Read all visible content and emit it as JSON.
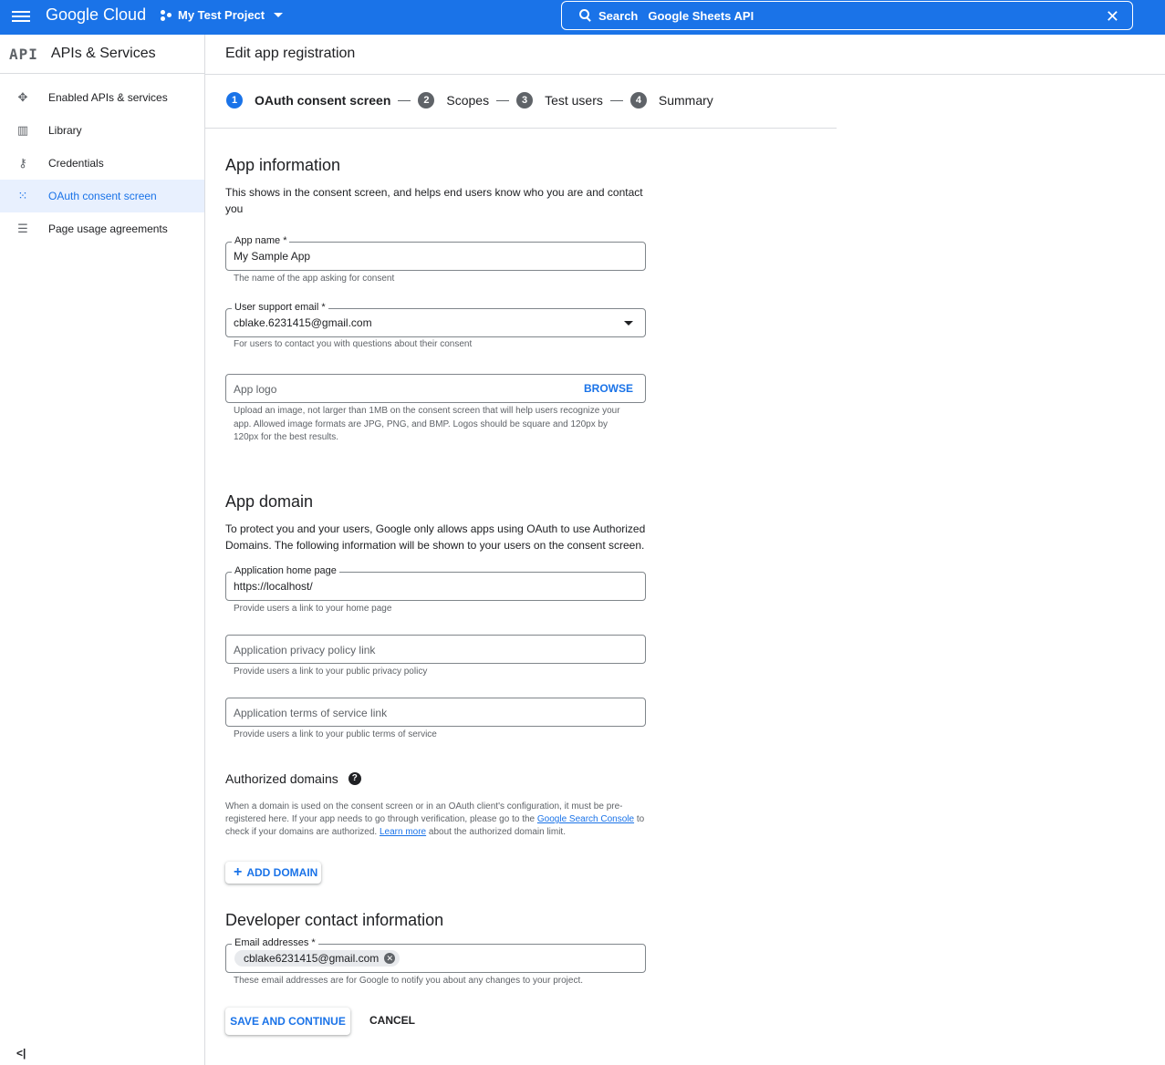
{
  "topbar": {
    "brand": "Google Cloud",
    "project": "My Test Project",
    "search_label": "Search",
    "search_query": "Google Sheets API"
  },
  "sidebar": {
    "logo": "API",
    "title": "APIs & Services",
    "items": [
      {
        "label": "Enabled APIs & services",
        "icon": "diamond-nodes-icon"
      },
      {
        "label": "Library",
        "icon": "library-icon"
      },
      {
        "label": "Credentials",
        "icon": "key-icon"
      },
      {
        "label": "OAuth consent screen",
        "icon": "consent-grid-icon",
        "active": true
      },
      {
        "label": "Page usage agreements",
        "icon": "settings-list-icon"
      }
    ],
    "collapse": "<|"
  },
  "page": {
    "title": "Edit app registration"
  },
  "steps": [
    {
      "num": "1",
      "label": "OAuth consent screen",
      "active": true
    },
    {
      "num": "2",
      "label": "Scopes"
    },
    {
      "num": "3",
      "label": "Test users"
    },
    {
      "num": "4",
      "label": "Summary"
    }
  ],
  "app_info": {
    "heading": "App information",
    "desc": "This shows in the consent screen, and helps end users know who you are and contact you",
    "app_name_label": "App name *",
    "app_name_value": "My Sample App",
    "app_name_hint": "The name of the app asking for consent",
    "support_email_label": "User support email *",
    "support_email_value": "cblake.6231415@gmail.com",
    "support_email_hint": "For users to contact you with questions about their consent",
    "logo_placeholder": "App logo",
    "browse": "BROWSE",
    "logo_hint": "Upload an image, not larger than 1MB on the consent screen that will help users recognize your app. Allowed image formats are JPG, PNG, and BMP. Logos should be square and 120px by 120px for the best results."
  },
  "app_domain": {
    "heading": "App domain",
    "desc": "To protect you and your users, Google only allows apps using OAuth to use Authorized Domains. The following information will be shown to your users on the consent screen.",
    "home_label": "Application home page",
    "home_value": "https://localhost/",
    "home_hint": "Provide users a link to your home page",
    "privacy_placeholder": "Application privacy policy link",
    "privacy_hint": "Provide users a link to your public privacy policy",
    "terms_placeholder": "Application terms of service link",
    "terms_hint": "Provide users a link to your public terms of service"
  },
  "authorized_domains": {
    "heading": "Authorized domains",
    "help": "?",
    "desc_1": "When a domain is used on the consent screen or in an OAuth client's configuration, it must be pre-registered here. If your app needs to go through verification, please go to the ",
    "link_1": "Google Search Console",
    "desc_2": " to check if your domains are authorized. ",
    "link_2": "Learn more",
    "desc_3": " about the authorized domain limit.",
    "add_button": "ADD DOMAIN"
  },
  "developer": {
    "heading": "Developer contact information",
    "email_label": "Email addresses *",
    "email_chip": "cblake6231415@gmail.com",
    "email_hint": "These email addresses are for Google to notify you about any changes to your project."
  },
  "actions": {
    "save": "SAVE AND CONTINUE",
    "cancel": "CANCEL"
  }
}
